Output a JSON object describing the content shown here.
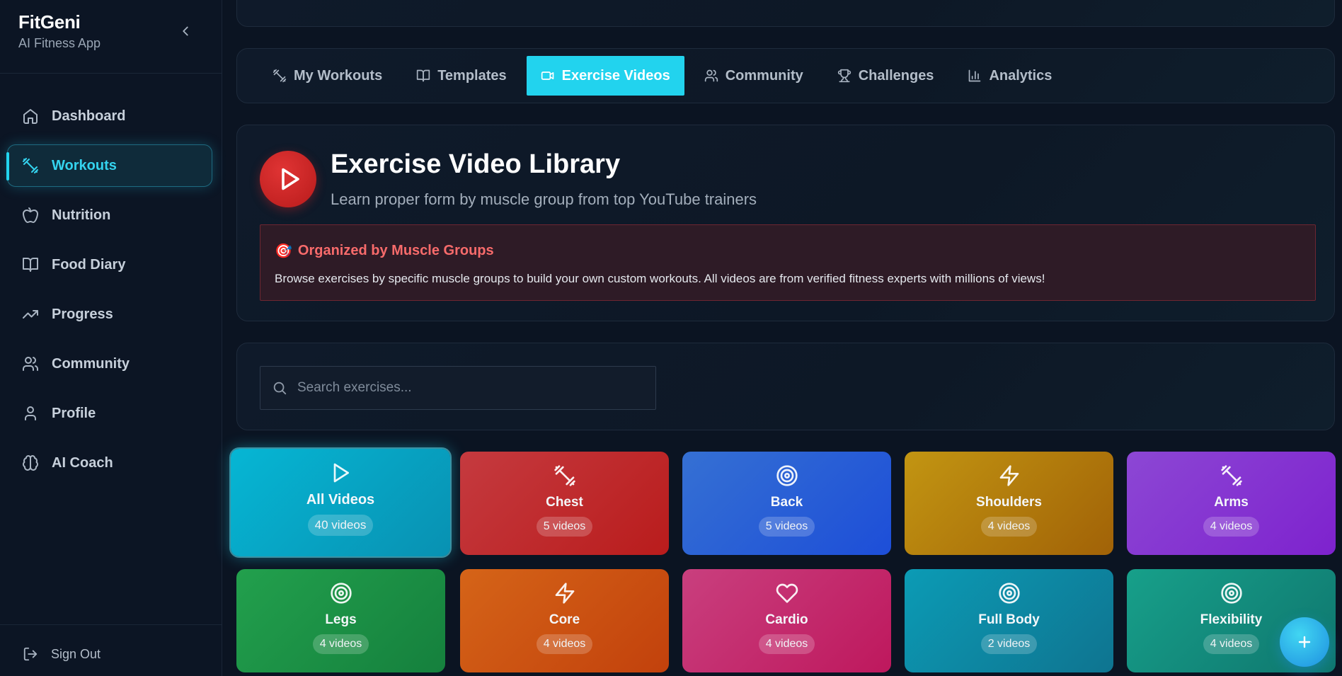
{
  "app": {
    "name": "FitGeni",
    "subtitle": "AI Fitness App"
  },
  "sidebar": {
    "items": [
      {
        "label": "Dashboard",
        "icon": "home-icon",
        "active": false
      },
      {
        "label": "Workouts",
        "icon": "dumbbell-icon",
        "active": true
      },
      {
        "label": "Nutrition",
        "icon": "apple-icon",
        "active": false
      },
      {
        "label": "Food Diary",
        "icon": "book-icon",
        "active": false
      },
      {
        "label": "Progress",
        "icon": "trending-up-icon",
        "active": false
      },
      {
        "label": "Community",
        "icon": "users-icon",
        "active": false
      },
      {
        "label": "Profile",
        "icon": "user-icon",
        "active": false
      },
      {
        "label": "AI Coach",
        "icon": "brain-icon",
        "active": false
      }
    ],
    "sign_out": "Sign Out"
  },
  "tabs": [
    {
      "label": "My Workouts",
      "icon": "dumbbell-icon",
      "active": false
    },
    {
      "label": "Templates",
      "icon": "book-icon",
      "active": false
    },
    {
      "label": "Exercise Videos",
      "icon": "video-icon",
      "active": true
    },
    {
      "label": "Community",
      "icon": "users-icon",
      "active": false
    },
    {
      "label": "Challenges",
      "icon": "trophy-icon",
      "active": false
    },
    {
      "label": "Analytics",
      "icon": "bar-chart-icon",
      "active": false
    }
  ],
  "library": {
    "title": "Exercise Video Library",
    "subtitle": "Learn proper form by muscle group from top YouTube trainers",
    "info_icon": "🎯",
    "info_title": "Organized by Muscle Groups",
    "info_text": "Browse exercises by specific muscle groups to build your own custom workouts. All videos are from verified fitness experts with millions of views!"
  },
  "search": {
    "placeholder": "Search exercises..."
  },
  "categories": [
    {
      "name": "All Videos",
      "count": "40 videos",
      "icon": "play-icon",
      "selected": true,
      "color_from": "#06b6d4",
      "color_to": "#0891b2"
    },
    {
      "name": "Chest",
      "count": "5 videos",
      "icon": "dumbbell-icon",
      "selected": false,
      "color_from": "#c53a3f",
      "color_to": "#b91c1c"
    },
    {
      "name": "Back",
      "count": "5 videos",
      "icon": "target-icon",
      "selected": false,
      "color_from": "#3570d3",
      "color_to": "#1d4ed8"
    },
    {
      "name": "Shoulders",
      "count": "4 videos",
      "icon": "zap-icon",
      "selected": false,
      "color_from": "#c29512",
      "color_to": "#a16207"
    },
    {
      "name": "Arms",
      "count": "4 videos",
      "icon": "dumbbell-icon",
      "selected": false,
      "color_from": "#8c47d4",
      "color_to": "#7e22ce"
    },
    {
      "name": "Legs",
      "count": "4 videos",
      "icon": "target-icon",
      "selected": false,
      "color_from": "#22a04d",
      "color_to": "#15803d"
    },
    {
      "name": "Core",
      "count": "4 videos",
      "icon": "zap-icon",
      "selected": false,
      "color_from": "#d56418",
      "color_to": "#c2410c"
    },
    {
      "name": "Cardio",
      "count": "4 videos",
      "icon": "heart-icon",
      "selected": false,
      "color_from": "#c93f7e",
      "color_to": "#be185d"
    },
    {
      "name": "Full Body",
      "count": "2 videos",
      "icon": "target-icon",
      "selected": false,
      "color_from": "#0c9bb5",
      "color_to": "#0e7490"
    },
    {
      "name": "Flexibility",
      "count": "4 videos",
      "icon": "target-icon",
      "selected": false,
      "color_from": "#17a08a",
      "color_to": "#0f766e"
    }
  ],
  "colors": {
    "accent": "#22d3ee",
    "danger": "#dc2626",
    "background": "#0b1422"
  }
}
